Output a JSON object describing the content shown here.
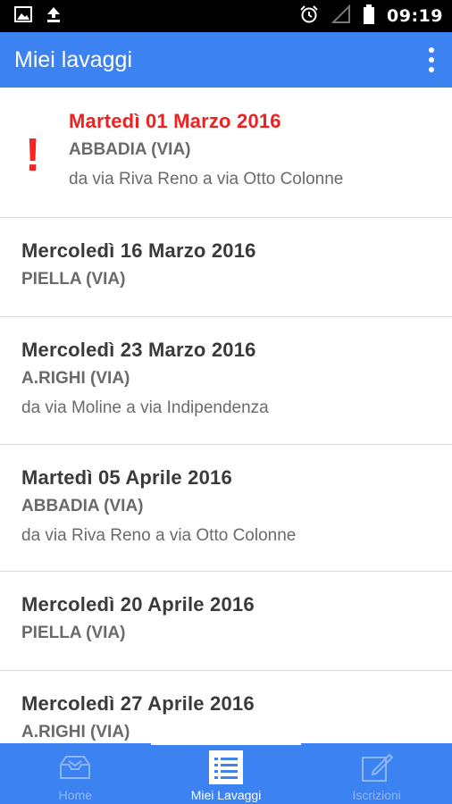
{
  "status_bar": {
    "left_icons": [
      "image-icon",
      "upload-icon"
    ],
    "right_icons": [
      "alarm-icon",
      "signal-icon",
      "battery-icon"
    ],
    "time": "09:19"
  },
  "app_bar": {
    "title": "Miei lavaggi",
    "menu_icon": "overflow-menu-icon"
  },
  "washes": [
    {
      "date": "Martedì 01 Marzo 2016",
      "street": "ABBADIA (VIA)",
      "range": "da via Riva Reno a via Otto Colonne",
      "alert": "!"
    },
    {
      "date": "Mercoledì 16 Marzo 2016",
      "street": "PIELLA (VIA)",
      "range": ""
    },
    {
      "date": "Mercoledì 23 Marzo 2016",
      "street": "A.RIGHI (VIA)",
      "range": "da via Moline a via Indipendenza"
    },
    {
      "date": "Martedì 05 Aprile 2016",
      "street": "ABBADIA (VIA)",
      "range": "da via Riva Reno a via Otto Colonne"
    },
    {
      "date": "Mercoledì 20 Aprile 2016",
      "street": "PIELLA (VIA)",
      "range": ""
    },
    {
      "date": "Mercoledì 27 Aprile 2016",
      "street": "A.RIGHI (VIA)",
      "range": ""
    }
  ],
  "bottom_nav": {
    "tabs": [
      {
        "label": "Home",
        "icon": "inbox-icon",
        "active": false
      },
      {
        "label": "Miei Lavaggi",
        "icon": "list-icon",
        "active": true
      },
      {
        "label": "Iscrizioni",
        "icon": "edit-icon",
        "active": false
      }
    ]
  },
  "colors": {
    "primary": "#3d82f1",
    "alert": "#ef2020",
    "status_bar": "#000000"
  }
}
